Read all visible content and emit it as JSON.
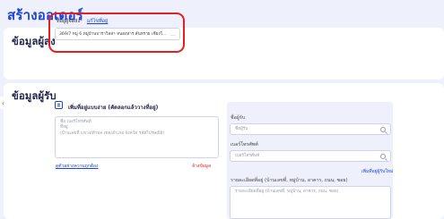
{
  "page": {
    "title": "สร้างออเดอร์"
  },
  "sender": {
    "section_title": "ข้อมูลผู้ส่ง",
    "label": "ที่อยู่ผู้จัดส่ง",
    "required_mark": "*",
    "edit_link": "แก้ไขที่อยู่",
    "address": "369/7 หมู่ 6 หมู่บ้านบาราวิลล่า หนองหาร สันทราย เชียงใ..."
  },
  "receiver": {
    "section_title": "ข้อมูลผู้รับ",
    "quick_add_title": "เพิ่มที่อยู่แบบง่าย (คัดลอกแล้ววางที่อยู่)",
    "paste_placeholder_lines": [
      "ชื่อ เบอร์โทรศัพท์",
      "ที่อยู่",
      "(บ้านเลขที่ แขวง/ตำบล เขต/อำเภอ จังหวัด รหัสไปรษณีย์)"
    ],
    "example_link": "ดูตัวอย่างความถูกต้อง",
    "clear_link": "ล้างข้อมูล",
    "name_label": "ชื่อผู้รับ",
    "name_placeholder": "ชื่อผู้รับ",
    "phone_label": "เบอร์โทรศัพท์",
    "phone_placeholder": "เบอร์โทรศัพท์",
    "add_from_book": "เพิ่มที่อยู่ผู้รับใหม่",
    "detail_label": "รายละเอียดที่อยู่ (บ้านเลขที่, หมู่บ้าน, อาคาร, ถนน, ซอย)",
    "detail_placeholder": "รายละเอียดที่อยู่ (บ้านเลขที่, หมู่บ้าน, อาคาร, ถนน, ซอย)"
  },
  "icons": {
    "side_toggle": "chevron-left-icon",
    "quick_add": "clipboard-icon",
    "search": "search-icon",
    "more": "more-dots-icon"
  },
  "colors": {
    "accent": "#1d43d8",
    "alert": "#e32020",
    "background": "#eef0fb"
  }
}
